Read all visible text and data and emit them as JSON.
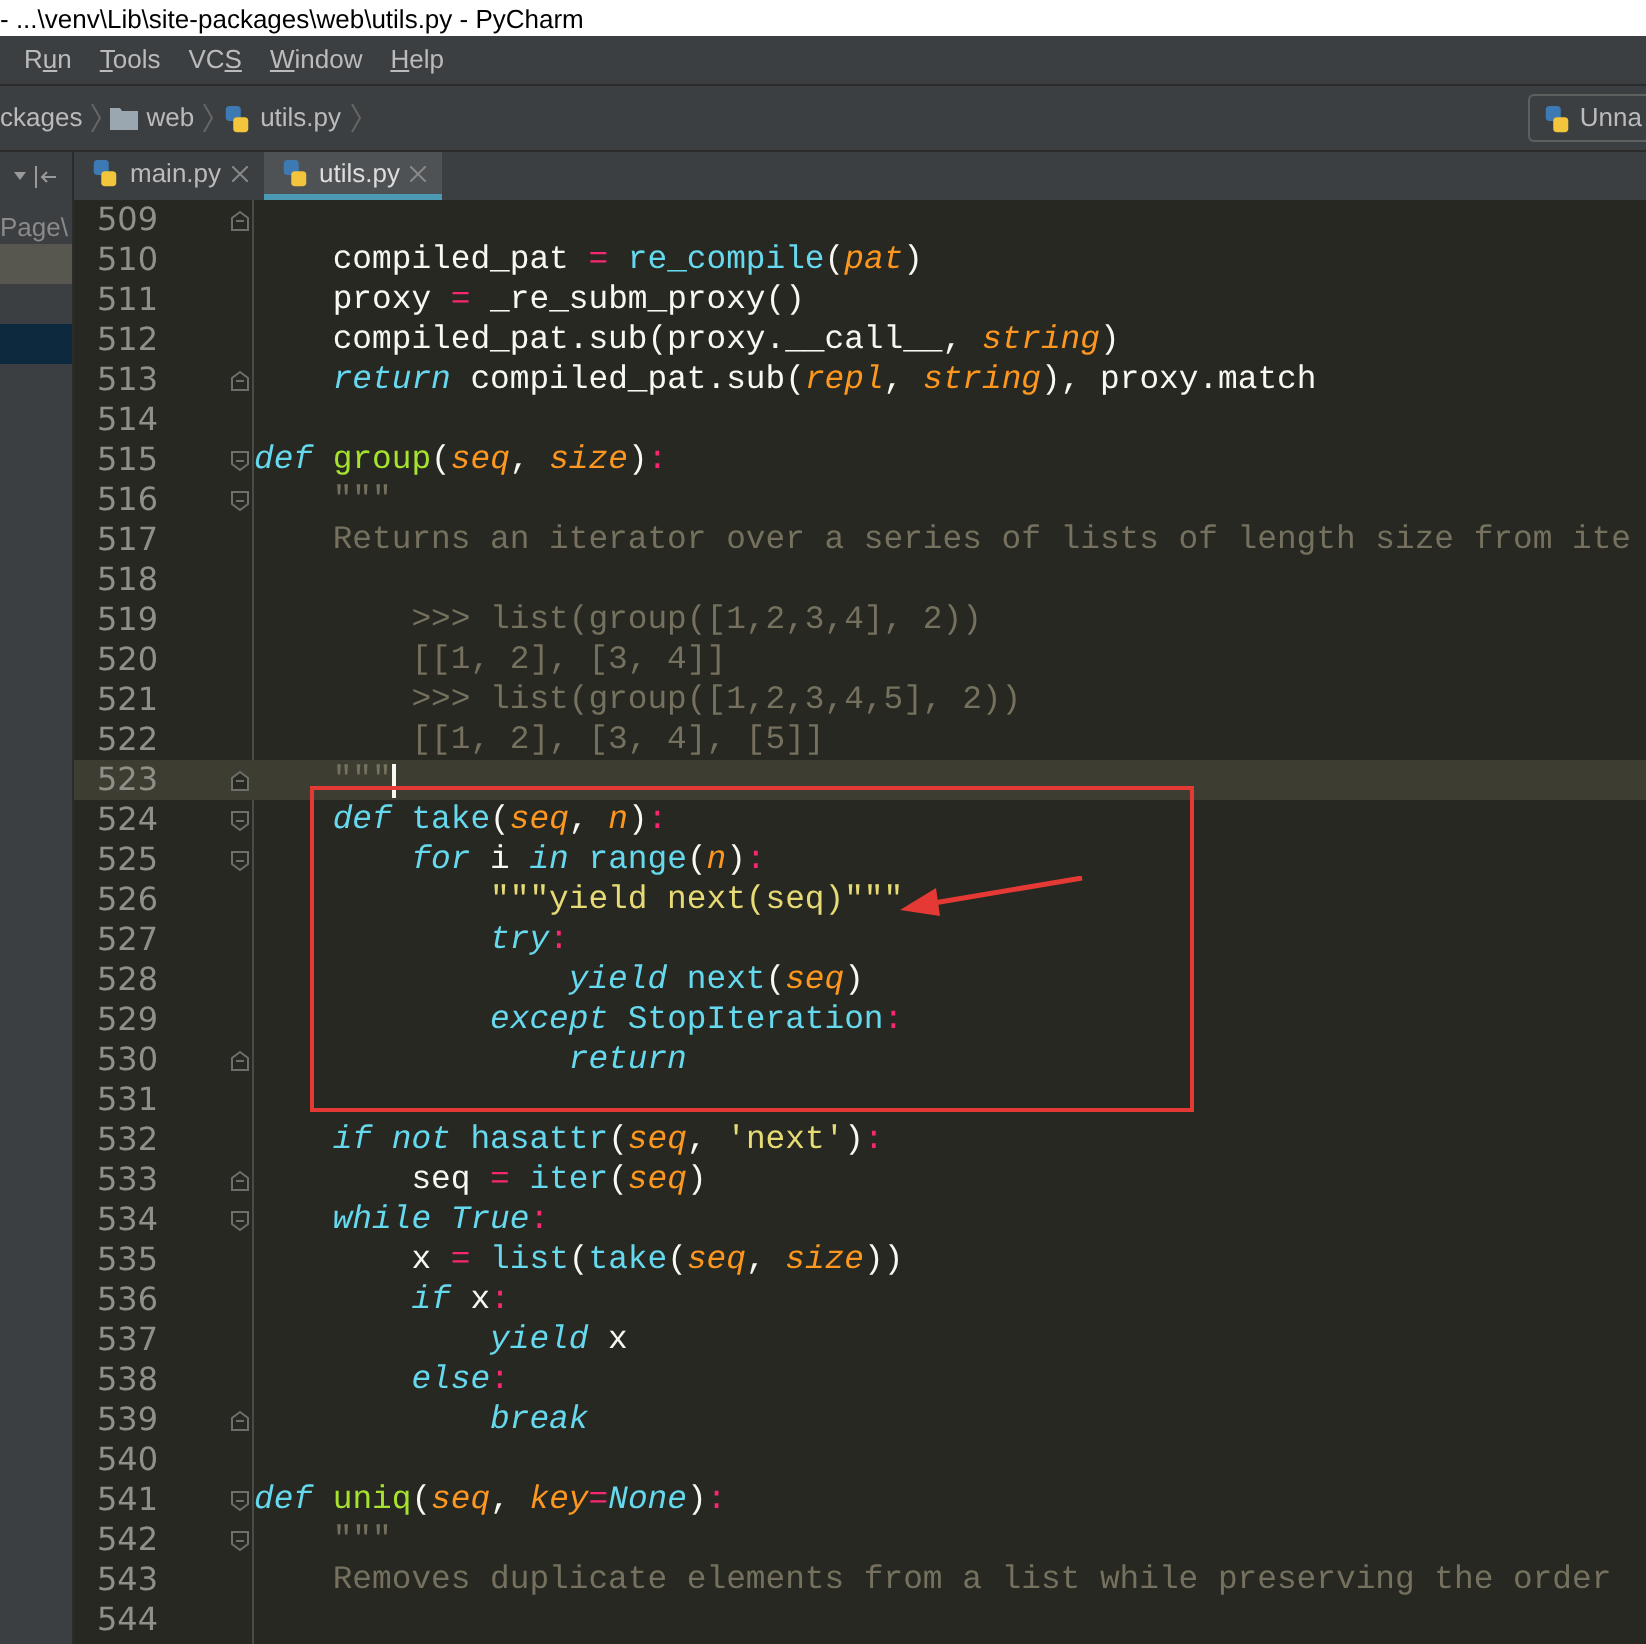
{
  "window": {
    "title": "- ...\\venv\\Lib\\site-packages\\web\\utils.py - PyCharm"
  },
  "menu": [
    {
      "before": "R",
      "key": "u",
      "after": "n"
    },
    {
      "key": "T",
      "after": "ools"
    },
    {
      "before": "VC",
      "key": "S"
    },
    {
      "key": "W",
      "after": "indow"
    },
    {
      "key": "H",
      "after": "elp"
    }
  ],
  "breadcrumb": [
    {
      "kind": "text",
      "label": "ckages"
    },
    {
      "kind": "folder",
      "label": "web"
    },
    {
      "kind": "python",
      "label": "utils.py"
    }
  ],
  "run_config": {
    "label": "Unna"
  },
  "tabs": [
    {
      "label": "main.py",
      "selected": false
    },
    {
      "label": "utils.py",
      "selected": true
    }
  ],
  "project_panel": {
    "rows": [
      {
        "label": "Page\\",
        "selected": false
      },
      {
        "selected": false,
        "highlighted": true
      },
      {
        "selected": true
      }
    ]
  },
  "lines": [
    {
      "number": "509",
      "fold_close": true
    },
    {
      "number": "510",
      "tokens": [
        {
          "kind": "plain",
          "text": "    compiled_pat "
        },
        {
          "kind": "op",
          "text": "="
        },
        {
          "kind": "call",
          "text": " re_compile"
        },
        {
          "kind": "plain",
          "text": "("
        },
        {
          "kind": "param",
          "text": "pat"
        },
        {
          "kind": "plain",
          "text": ")"
        }
      ]
    },
    {
      "number": "511",
      "tokens": [
        {
          "kind": "plain",
          "text": "    proxy "
        },
        {
          "kind": "op",
          "text": "="
        },
        {
          "kind": "plain",
          "text": " _re_subm_proxy()"
        }
      ]
    },
    {
      "number": "512",
      "tokens": [
        {
          "kind": "plain",
          "text": "    compiled_pat.sub(proxy.__call__, "
        },
        {
          "kind": "param",
          "text": "string"
        },
        {
          "kind": "plain",
          "text": ")"
        }
      ]
    },
    {
      "number": "513",
      "fold_close": true,
      "tokens": [
        {
          "kind": "kw",
          "text": "    return"
        },
        {
          "kind": "plain",
          "text": " compiled_pat.sub("
        },
        {
          "kind": "param",
          "text": "repl"
        },
        {
          "kind": "plain",
          "text": ", "
        },
        {
          "kind": "param",
          "text": "string"
        },
        {
          "kind": "plain",
          "text": "), proxy.match"
        }
      ]
    },
    {
      "number": "514"
    },
    {
      "number": "515",
      "fold_open": true,
      "tokens": [
        {
          "kind": "kw",
          "text": "def"
        },
        {
          "kind": "fn",
          "text": " group"
        },
        {
          "kind": "plain",
          "text": "("
        },
        {
          "kind": "param",
          "text": "seq"
        },
        {
          "kind": "plain",
          "text": ", "
        },
        {
          "kind": "param",
          "text": "size"
        },
        {
          "kind": "plain",
          "text": ")"
        },
        {
          "kind": "op",
          "text": ":"
        }
      ]
    },
    {
      "number": "516",
      "fold_open": true,
      "tokens": [
        {
          "kind": "doc",
          "text": "    \"\"\""
        }
      ]
    },
    {
      "number": "517",
      "tokens": [
        {
          "kind": "doc",
          "text": "    Returns an iterator over a series of lists of length size from ite"
        }
      ]
    },
    {
      "number": "518"
    },
    {
      "number": "519",
      "tokens": [
        {
          "kind": "doc",
          "text": "        >>> list(group([1,2,3,4], 2))"
        }
      ]
    },
    {
      "number": "520",
      "tokens": [
        {
          "kind": "doc",
          "text": "        [[1, 2], [3, 4]]"
        }
      ]
    },
    {
      "number": "521",
      "tokens": [
        {
          "kind": "doc",
          "text": "        >>> list(group([1,2,3,4,5], 2))"
        }
      ]
    },
    {
      "number": "522",
      "tokens": [
        {
          "kind": "doc",
          "text": "        [[1, 2], [3, 4], [5]]"
        }
      ]
    },
    {
      "number": "523",
      "fold_close": true,
      "current": true,
      "tokens": [
        {
          "kind": "doc",
          "text": "    \"\"\""
        }
      ]
    },
    {
      "kind": "box",
      "lines": [
        {
          "number": "524",
          "fold_open": true,
          "tokens": [
            {
              "kind": "kw",
              "text": "    def"
            },
            {
              "kind": "call",
              "text": " take"
            },
            {
              "kind": "plain",
              "text": "("
            },
            {
              "kind": "param",
              "text": "seq"
            },
            {
              "kind": "plain",
              "text": ", "
            },
            {
              "kind": "param",
              "text": "n"
            },
            {
              "kind": "plain",
              "text": ")"
            },
            {
              "kind": "op",
              "text": ":"
            }
          ]
        },
        {
          "number": "525",
          "fold_open": true,
          "tokens": [
            {
              "kind": "kw",
              "text": "        for"
            },
            {
              "kind": "plain",
              "text": " i "
            },
            {
              "kind": "kw",
              "text": "in"
            },
            {
              "kind": "call",
              "text": " range"
            },
            {
              "kind": "plain",
              "text": "("
            },
            {
              "kind": "param",
              "text": "n"
            },
            {
              "kind": "plain",
              "text": ")"
            },
            {
              "kind": "op",
              "text": ":"
            }
          ]
        },
        {
          "number": "526",
          "arrow": true,
          "tokens": [
            {
              "kind": "str",
              "text": "            \"\"\"yield next(seq)\"\"\""
            }
          ]
        },
        {
          "number": "527",
          "tokens": [
            {
              "kind": "kw",
              "text": "            try"
            },
            {
              "kind": "op",
              "text": ":"
            }
          ]
        },
        {
          "number": "528",
          "tokens": [
            {
              "kind": "kw",
              "text": "                yield"
            },
            {
              "kind": "call",
              "text": " next"
            },
            {
              "kind": "plain",
              "text": "("
            },
            {
              "kind": "param",
              "text": "seq"
            },
            {
              "kind": "plain",
              "text": ")"
            }
          ]
        },
        {
          "number": "529",
          "tokens": [
            {
              "kind": "kw",
              "text": "            except"
            },
            {
              "kind": "call",
              "text": " StopIteration"
            },
            {
              "kind": "op",
              "text": ":"
            }
          ]
        },
        {
          "number": "530",
          "fold_close": true,
          "tokens": [
            {
              "kind": "kw",
              "text": "                return"
            }
          ]
        },
        {
          "number": "531"
        }
      ]
    },
    {
      "number": "532",
      "tokens": [
        {
          "kind": "kw",
          "text": "    if not"
        },
        {
          "kind": "call",
          "text": " hasattr"
        },
        {
          "kind": "plain",
          "text": "("
        },
        {
          "kind": "param",
          "text": "seq"
        },
        {
          "kind": "plain",
          "text": ", "
        },
        {
          "kind": "str",
          "text": "'next'"
        },
        {
          "kind": "plain",
          "text": ")"
        },
        {
          "kind": "op",
          "text": ":"
        }
      ]
    },
    {
      "number": "533",
      "fold_close": true,
      "tokens": [
        {
          "kind": "plain",
          "text": "        seq "
        },
        {
          "kind": "op",
          "text": "="
        },
        {
          "kind": "call",
          "text": " iter"
        },
        {
          "kind": "plain",
          "text": "("
        },
        {
          "kind": "param",
          "text": "seq"
        },
        {
          "kind": "plain",
          "text": ")"
        }
      ]
    },
    {
      "number": "534",
      "fold_open": true,
      "tokens": [
        {
          "kind": "kw",
          "text": "    while True"
        },
        {
          "kind": "op",
          "text": ":"
        }
      ]
    },
    {
      "number": "535",
      "tokens": [
        {
          "kind": "plain",
          "text": "        x "
        },
        {
          "kind": "op",
          "text": "="
        },
        {
          "kind": "call",
          "text": " list"
        },
        {
          "kind": "plain",
          "text": "("
        },
        {
          "kind": "call",
          "text": "take"
        },
        {
          "kind": "plain",
          "text": "("
        },
        {
          "kind": "param",
          "text": "seq"
        },
        {
          "kind": "plain",
          "text": ", "
        },
        {
          "kind": "param",
          "text": "size"
        },
        {
          "kind": "plain",
          "text": "))"
        }
      ]
    },
    {
      "number": "536",
      "tokens": [
        {
          "kind": "kw",
          "text": "        if"
        },
        {
          "kind": "plain",
          "text": " x"
        },
        {
          "kind": "op",
          "text": ":"
        }
      ]
    },
    {
      "number": "537",
      "tokens": [
        {
          "kind": "kw",
          "text": "            yield"
        },
        {
          "kind": "plain",
          "text": " x"
        }
      ]
    },
    {
      "number": "538",
      "tokens": [
        {
          "kind": "kw",
          "text": "        else"
        },
        {
          "kind": "op",
          "text": ":"
        }
      ]
    },
    {
      "number": "539",
      "fold_close": true,
      "tokens": [
        {
          "kind": "kw",
          "text": "            break"
        }
      ]
    },
    {
      "number": "540"
    },
    {
      "number": "541",
      "fold_open": true,
      "tokens": [
        {
          "kind": "kw",
          "text": "def"
        },
        {
          "kind": "fn",
          "text": " uniq"
        },
        {
          "kind": "plain",
          "text": "("
        },
        {
          "kind": "param",
          "text": "seq"
        },
        {
          "kind": "plain",
          "text": ", "
        },
        {
          "kind": "param",
          "text": "key"
        },
        {
          "kind": "op",
          "text": "="
        },
        {
          "kind": "kw",
          "text": "None"
        },
        {
          "kind": "plain",
          "text": ")"
        },
        {
          "kind": "op",
          "text": ":"
        }
      ]
    },
    {
      "number": "542",
      "fold_open": true,
      "tokens": [
        {
          "kind": "doc",
          "text": "    \"\"\""
        }
      ]
    },
    {
      "number": "543",
      "tokens": [
        {
          "kind": "doc",
          "text": "    Removes duplicate elements from a list while preserving the order"
        }
      ]
    },
    {
      "number": "544"
    }
  ]
}
